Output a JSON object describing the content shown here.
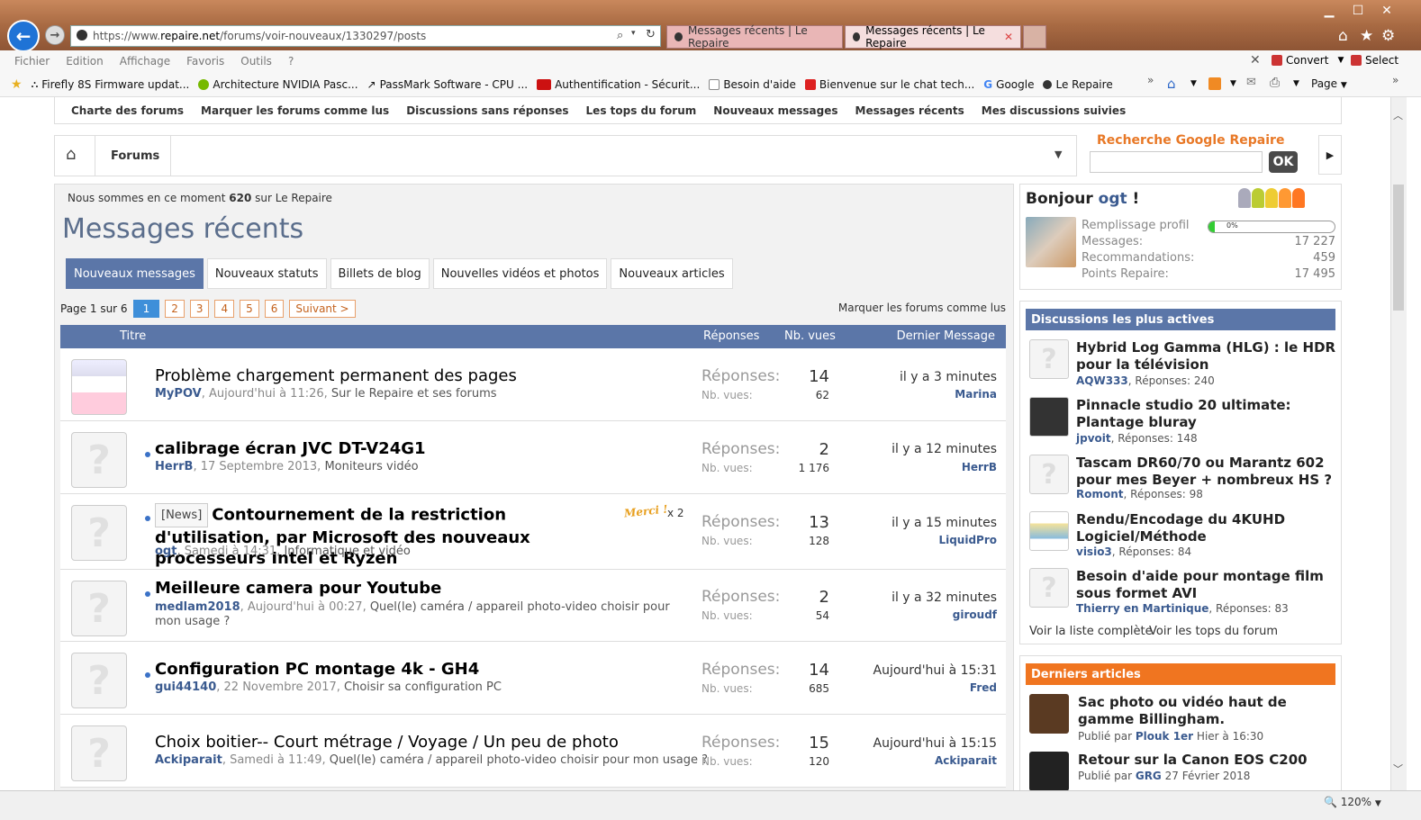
{
  "browser": {
    "url_prefix": "https://www.",
    "url_domain": "repaire.net",
    "url_path": "/forums/voir-nouveaux/1330297/posts",
    "tabs": [
      {
        "label": "Messages récents | Le Repaire"
      },
      {
        "label": "Messages récents | Le Repaire"
      }
    ],
    "menu": [
      "Fichier",
      "Edition",
      "Affichage",
      "Favoris",
      "Outils",
      "?"
    ],
    "convert_label": "Convert",
    "select_label": "Select",
    "favorites": [
      "Firefly 8S Firmware updat...",
      "Architecture NVIDIA Pasc...",
      "PassMark Software - CPU ...",
      "Authentification - Sécurit...",
      "Besoin d'aide",
      "Bienvenue sur le chat tech...",
      "Google",
      "Le Repaire"
    ],
    "page_menu": "Page",
    "zoom": "120%"
  },
  "subnav": [
    "Charte des forums",
    "Marquer les forums comme lus",
    "Discussions sans réponses",
    "Les tops du forum",
    "Nouveaux messages",
    "Messages récents",
    "Mes discussions suivies"
  ],
  "breadcrumb": {
    "forums": "Forums"
  },
  "search": {
    "label": "Recherche Google Repaire",
    "ok": "OK"
  },
  "main": {
    "online_prefix": "Nous sommes en ce moment ",
    "online_count": "620",
    "online_suffix": " sur Le Repaire",
    "title": "Messages récents",
    "tabs": [
      "Nouveaux messages",
      "Nouveaux statuts",
      "Billets de blog",
      "Nouvelles vidéos et photos",
      "Nouveaux articles"
    ],
    "page_info": "Page 1 sur 6",
    "pages": [
      "1",
      "2",
      "3",
      "4",
      "5",
      "6"
    ],
    "next": "Suivant >",
    "mark_read": "Marquer les forums comme lus",
    "columns": {
      "title": "Titre",
      "replies": "Réponses",
      "views": "Nb. vues",
      "last": "Dernier Message"
    },
    "replies_label": "Réponses:",
    "views_label": "Nb. vues:",
    "merci": "Merci !",
    "merci_count": "x 2",
    "news_badge": "[News]",
    "threads": [
      {
        "title": "Problème chargement permanent des pages",
        "author": "MyPOV",
        "date": "Aujourd'hui à 11:26",
        "forum": "Sur le Repaire et ses forums",
        "replies": "14",
        "views": "62",
        "last_when": "il y a 3 minutes",
        "last_user": "Marina"
      },
      {
        "title": "calibrage écran JVC DT-V24G1",
        "author": "HerrB",
        "date": "17 Septembre 2013",
        "forum": "Moniteurs vidéo",
        "replies": "2",
        "views": "1 176",
        "last_when": "il y a 12 minutes",
        "last_user": "HerrB"
      },
      {
        "title": "Contournement de la restriction d'utilisation, par Microsoft des nouveaux processeurs Intel et Ryzen",
        "author": "ogt",
        "date": "Samedi à 14:31",
        "forum": "Informatique et vidéo",
        "replies": "13",
        "views": "128",
        "last_when": "il y a 15 minutes",
        "last_user": "LiquidPro"
      },
      {
        "title": "Meilleure camera pour Youtube",
        "author": "medlam2018",
        "date": "Aujourd'hui à 00:27",
        "forum": "Quel(le) caméra / appareil photo-video choisir pour mon usage ?",
        "replies": "2",
        "views": "54",
        "last_when": "il y a 32 minutes",
        "last_user": "giroudf"
      },
      {
        "title": "Configuration PC montage 4k - GH4",
        "author": "gui44140",
        "date": "22 Novembre 2017",
        "forum": "Choisir sa configuration PC",
        "replies": "14",
        "views": "685",
        "last_when": "Aujourd'hui à 15:31",
        "last_user": "Fred"
      },
      {
        "title": "Choix boitier-- Court métrage / Voyage / Un peu de photo",
        "author": "Ackiparait",
        "date": "Samedi à 11:49",
        "forum": "Quel(le) caméra / appareil photo-video choisir pour mon usage ?",
        "replies": "15",
        "views": "120",
        "last_when": "Aujourd'hui à 15:15",
        "last_user": "Ackiparait"
      }
    ]
  },
  "sidebar": {
    "hello_prefix": "Bonjour ",
    "username": "ogt",
    "hello_suffix": " !",
    "profile_fill_label": "Remplissage profil",
    "profile_fill_value": "0%",
    "profile_fill_fraction": 0.05,
    "stats": [
      {
        "label": "Messages:",
        "value": "17 227"
      },
      {
        "label": "Recommandations:",
        "value": "459"
      },
      {
        "label": "Points Repaire:",
        "value": "17 495"
      }
    ],
    "active_title": "Discussions les plus actives",
    "active": [
      {
        "title": "Hybrid Log Gamma (HLG) : le HDR pour la télévision",
        "author": "AQW333",
        "meta": ", Réponses: 240"
      },
      {
        "title": "Pinnacle studio 20 ultimate: Plantage bluray",
        "author": "jpvoit",
        "meta": ", Réponses: 148"
      },
      {
        "title": "Tascam DR60/70 ou Marantz 602 pour mes Beyer + nombreux HS ?",
        "author": "Romont",
        "meta": ", Réponses: 98"
      },
      {
        "title": "Rendu/Encodage du 4KUHD Logiciel/Méthode",
        "author": "visio3",
        "meta": ", Réponses: 84"
      },
      {
        "title": "Besoin d'aide pour montage film sous formet AVI",
        "author": "Thierry en Martinique",
        "meta": ", Réponses: 83"
      }
    ],
    "full_list": "Voir la liste complète",
    "tops": "Voir les tops du forum",
    "articles_title": "Derniers articles",
    "articles": [
      {
        "title": "Sac photo ou vidéo haut de gamme Billingham.",
        "by": "Publié par ",
        "author": "Plouk 1er",
        "date": " Hier à 16:30"
      },
      {
        "title": "Retour sur la Canon EOS C200",
        "by": "Publié par ",
        "author": "GRG",
        "date": " 27 Février 2018"
      }
    ]
  },
  "colors": {
    "accent_blue": "#5b76a8",
    "orange": "#e87826",
    "link": "#3a5a8f"
  }
}
